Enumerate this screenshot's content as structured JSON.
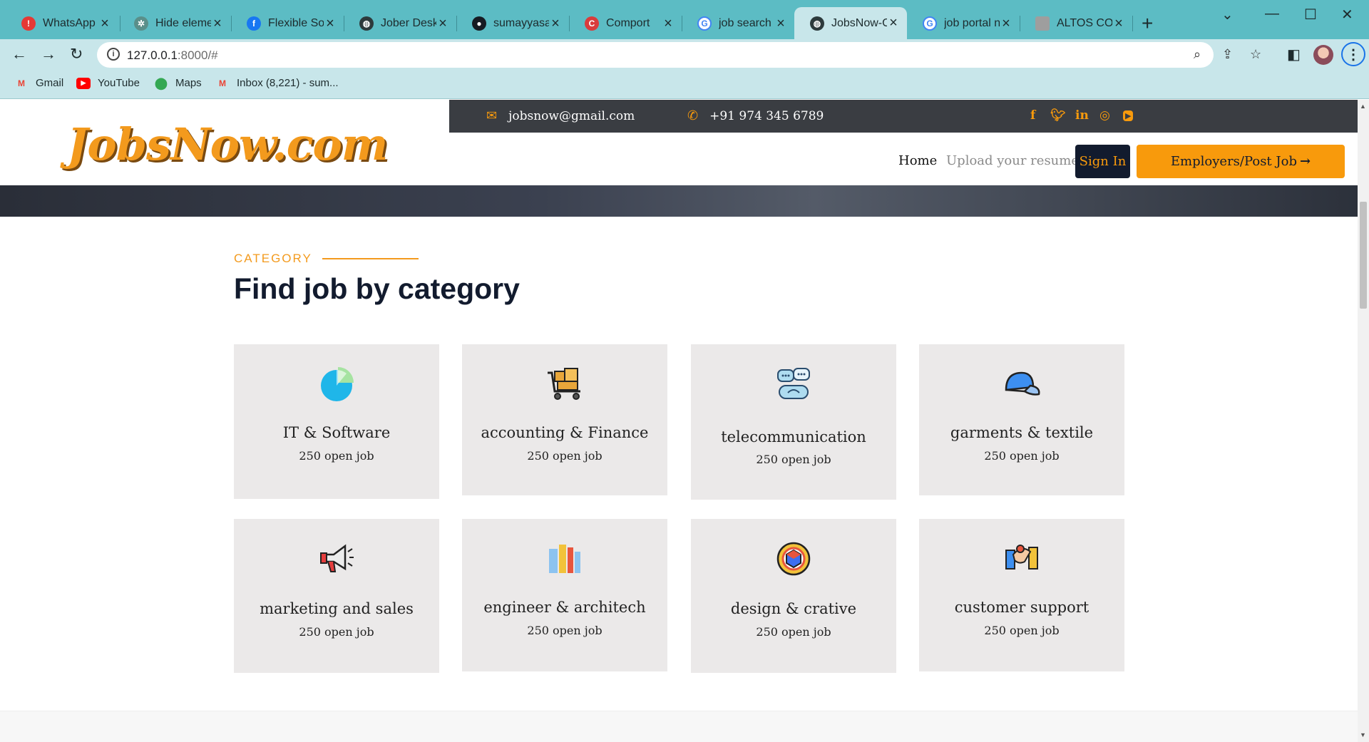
{
  "browser": {
    "tabs": [
      {
        "title": "WhatsApp",
        "icon": "whatsapp-icon",
        "color": "#e53935"
      },
      {
        "title": "Hide eleme",
        "icon": "chatgpt-icon",
        "color": "#5a8f8a"
      },
      {
        "title": "Flexible Sof",
        "icon": "facebook-icon",
        "color": "#1877f2"
      },
      {
        "title": "Jober Desk",
        "icon": "globe-icon",
        "color": "#2d3a3c"
      },
      {
        "title": "sumayyasar",
        "icon": "github-icon",
        "color": "#161b22"
      },
      {
        "title": "Comport",
        "icon": "canva-icon",
        "color": "#d93c3c"
      },
      {
        "title": "job search l",
        "icon": "google-icon",
        "color": "#4285f4"
      },
      {
        "title": "JobsNow-C",
        "icon": "globe-icon",
        "color": "#2d3a3c"
      },
      {
        "title": "job portal n",
        "icon": "google-icon",
        "color": "#4285f4"
      },
      {
        "title": "ALTOS COR",
        "icon": "document-icon",
        "color": "#9e9e9e"
      }
    ],
    "new_tab": "+",
    "url_host": "127.0.0.1",
    "url_rest": ":8000/#",
    "bookmarks": [
      {
        "label": "Gmail",
        "icon": "gmail-icon"
      },
      {
        "label": "YouTube",
        "icon": "youtube-icon"
      },
      {
        "label": "Maps",
        "icon": "maps-icon"
      },
      {
        "label": "Inbox (8,221) - sum...",
        "icon": "gmail-icon"
      }
    ]
  },
  "site": {
    "logo": "JobsNow.com",
    "email": "jobsnow@gmail.com",
    "phone": "+91 974 345 6789",
    "social": [
      "facebook-icon",
      "twitter-icon",
      "linkedin-icon",
      "instagram-icon",
      "youtube-icon"
    ],
    "nav": {
      "home": "Home",
      "upload": "Upload your resume",
      "signin": "Sign In",
      "post": "Employers/Post Job"
    },
    "accent": "#f89a0c",
    "dark": "#121b2e"
  },
  "category": {
    "label": "CATEGORY",
    "title": "Find job by category",
    "cards": [
      {
        "name": "IT & Software",
        "count": "250 open job",
        "icon": "pie-chart-icon"
      },
      {
        "name": "accounting & Finance",
        "count": "250 open job",
        "icon": "cart-boxes-icon"
      },
      {
        "name": "telecommunication",
        "count": "250 open job",
        "icon": "chat-bubbles-icon"
      },
      {
        "name": "garments & textile",
        "count": "250 open job",
        "icon": "cap-icon"
      },
      {
        "name": "marketing and sales",
        "count": "250 open job",
        "icon": "megaphone-icon"
      },
      {
        "name": "engineer & architech",
        "count": "250 open job",
        "icon": "blueprint-icon"
      },
      {
        "name": "design & crative",
        "count": "250 open job",
        "icon": "color-wheel-icon"
      },
      {
        "name": "customer support",
        "count": "250 open job",
        "icon": "handshake-icon"
      }
    ]
  }
}
